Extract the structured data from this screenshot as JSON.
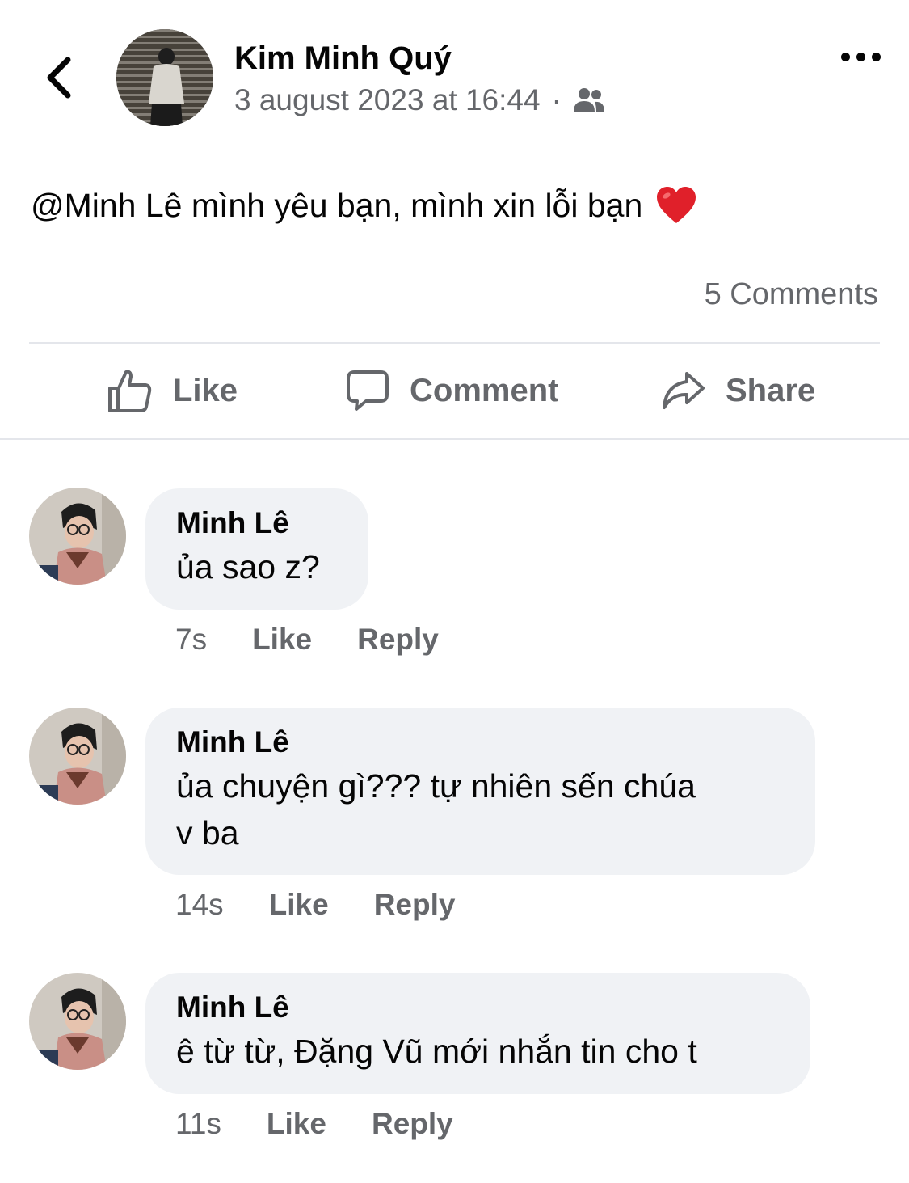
{
  "header": {
    "author_name": "Kim Minh Quý",
    "timestamp": "3 august 2023 at 16:44",
    "separator": "·",
    "audience_icon": "friends-icon",
    "back_icon": "chevron-left-icon",
    "more_icon": "more-horizontal-icon"
  },
  "post": {
    "mention": "@Minh Lê",
    "text": " mình yêu bạn, mình xin lỗi bạn",
    "emoji_icon": "red-heart-icon",
    "comments_count": "5 Comments"
  },
  "actions": {
    "like_label": "Like",
    "comment_label": "Comment",
    "share_label": "Share"
  },
  "comments": [
    {
      "author": "Minh Lê",
      "text": "ủa sao z?",
      "time": "7s",
      "like_label": "Like",
      "reply_label": "Reply"
    },
    {
      "author": "Minh Lê",
      "text_line1": "ủa chuyện gì??? tự nhiên sến chúa",
      "text_line2": "v ba",
      "time": "14s",
      "like_label": "Like",
      "reply_label": "Reply"
    },
    {
      "author": "Minh Lê",
      "text": "ê từ từ, Đặng Vũ mới nhắn tin cho t",
      "time": "11s",
      "like_label": "Like",
      "reply_label": "Reply"
    }
  ],
  "colors": {
    "text_primary": "#050505",
    "text_secondary": "#65676b",
    "bubble_bg": "#f0f2f5",
    "divider": "#e4e6eb",
    "heart": "#e0202a"
  }
}
